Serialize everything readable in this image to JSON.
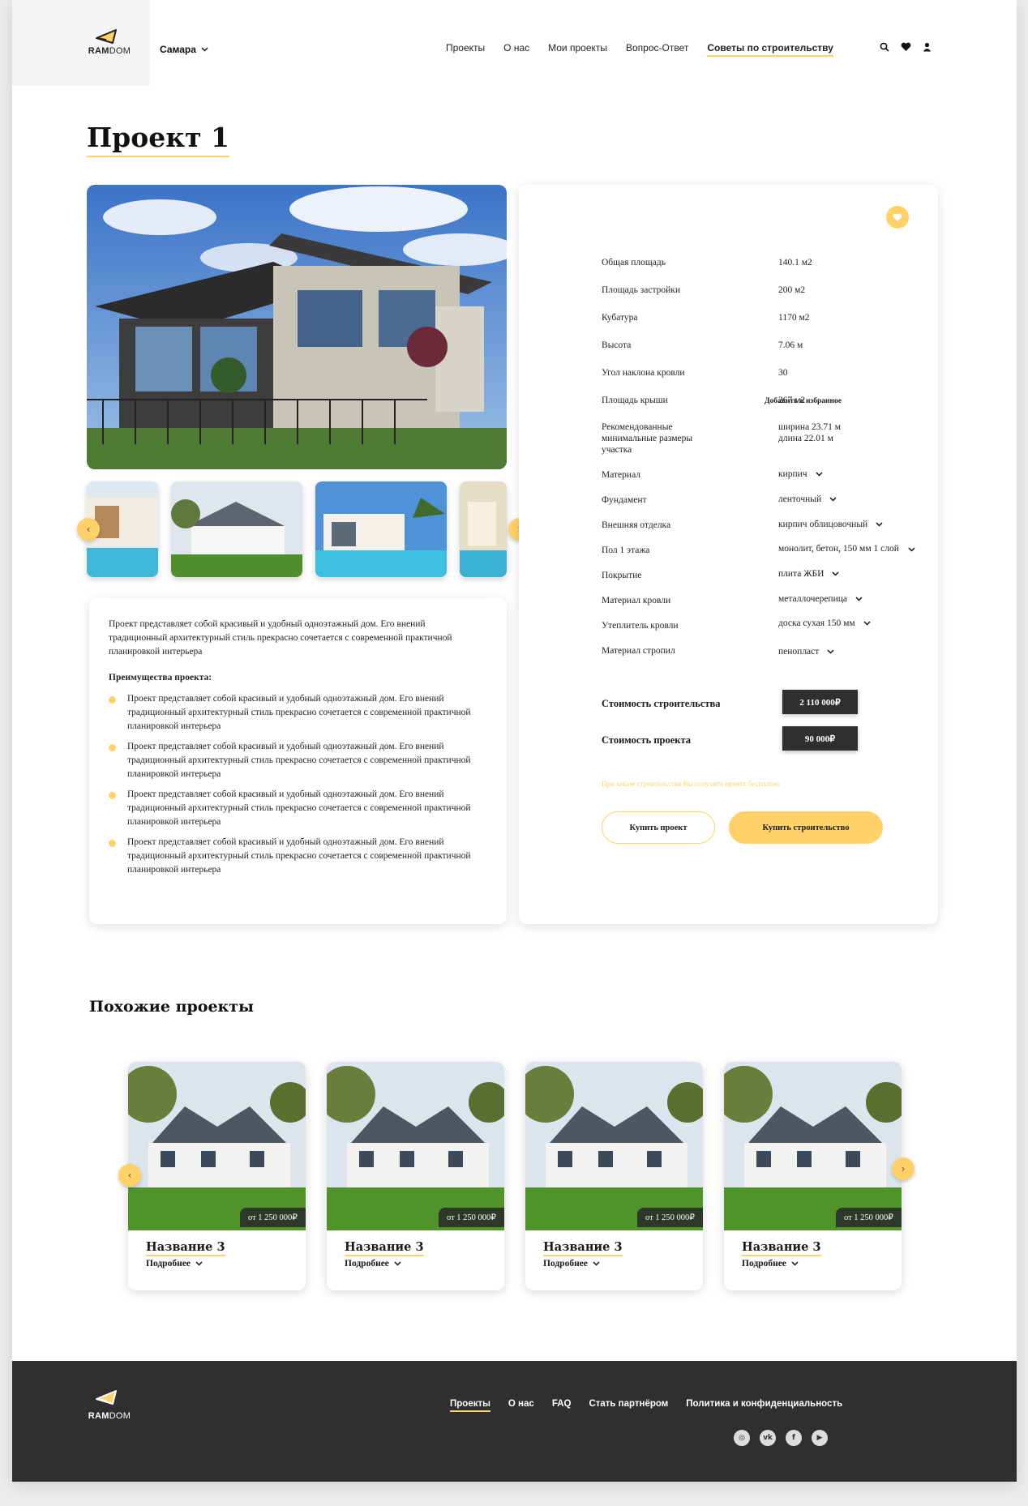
{
  "header": {
    "logo": {
      "text_bold": "RAM",
      "text_light": "DOM"
    },
    "city": "Самара",
    "nav": [
      {
        "label": "Проекты",
        "active": false
      },
      {
        "label": "О нас",
        "active": false
      },
      {
        "label": "Мои проекты",
        "active": false
      },
      {
        "label": "Вопрос-Ответ",
        "active": false
      },
      {
        "label": "Советы по строительству",
        "active": true
      }
    ],
    "icons": [
      "search-icon",
      "heart-icon",
      "user-icon"
    ]
  },
  "project": {
    "title": "Проект 1",
    "favorite_label": "Добавить в избранное",
    "specs": [
      {
        "label": "Общая площадь",
        "value": "140.1 м2"
      },
      {
        "label": "Площадь застройки",
        "value": "200 м2"
      },
      {
        "label": "Кубатура",
        "value": "1170 м2"
      },
      {
        "label": "Высота",
        "value": "7.06 м"
      },
      {
        "label": "Угол наклона кровли",
        "value": "30"
      },
      {
        "label": "Площадь крыши",
        "value": "267 м2"
      },
      {
        "label": "Рекомендованные минимальные размеры участка",
        "value": "ширина 23.71 м длина 22.01 м"
      }
    ],
    "options": [
      {
        "label": "Материал",
        "value": "кирпич"
      },
      {
        "label": "Фундамент",
        "value": "ленточный"
      },
      {
        "label": "Внешняя отделка",
        "value": "кирпич облицовочный"
      },
      {
        "label": "Пол 1 этажа",
        "value": "монолит, бетон, 150 мм 1 слой"
      },
      {
        "label": "Покрытие",
        "value": "плита ЖБИ"
      },
      {
        "label": "Материал кровли",
        "value": "металлочерепица"
      },
      {
        "label": "Утеплитель кровли",
        "value": "доска сухая 150 мм"
      },
      {
        "label": "Материал стропил",
        "value": "пенопласт"
      }
    ],
    "costs": [
      {
        "label": "Стоимость строительства",
        "value": "2 110 000₽"
      },
      {
        "label": "Стоимость проекта",
        "value": "90 000₽"
      }
    ],
    "promo": "При заказе строительства Вы получите проект бесплатно",
    "buy_project": "Купить проект",
    "buy_construction": "Купить строительство",
    "description": "Проект представляет собой красивый и удобный одноэтажный дом. Его внений традиционный архитектурный стиль прекрасно сочетается с современной практичной планировкой интерьера",
    "advantages_title": "Преимущества проекта:",
    "advantages": [
      "Проект представляет собой красивый и удобный одноэтажный дом. Его внений традиционный архитектурный стиль прекрасно сочетается с современной практичной планировкой интерьера",
      "Проект представляет собой красивый и удобный одноэтажный дом. Его внений традиционный архитектурный стиль прекрасно сочетается с современной практичной планировкой интерьера",
      "Проект представляет собой красивый и удобный одноэтажный дом. Его внений традиционный архитектурный стиль прекрасно сочетается с современной практичной планировкой интерьера",
      "Проект представляет собой красивый и удобный одноэтажный дом. Его внений традиционный архитектурный стиль прекрасно сочетается с современной практичной планировкой интерьера"
    ]
  },
  "similar": {
    "title": "Похожие проекты",
    "cards": [
      {
        "name": "Название 3",
        "price": "от 1 250 000₽",
        "more": "Подробнее"
      },
      {
        "name": "Название 3",
        "price": "от 1 250 000₽",
        "more": "Подробнее"
      },
      {
        "name": "Название 3",
        "price": "от 1 250 000₽",
        "more": "Подробнее"
      },
      {
        "name": "Название 3",
        "price": "от 1 250 000₽",
        "more": "Подробнее"
      }
    ]
  },
  "footer": {
    "nav": [
      {
        "label": "Проекты",
        "active": true
      },
      {
        "label": "О нас",
        "active": false
      },
      {
        "label": "FAQ",
        "active": false
      },
      {
        "label": "Стать партнёром",
        "active": false
      },
      {
        "label": "Политика и конфиденциальность",
        "active": false
      }
    ],
    "socials": [
      {
        "name": "instagram-icon",
        "glyph": "◎"
      },
      {
        "name": "vk-icon",
        "glyph": "vk"
      },
      {
        "name": "facebook-icon",
        "glyph": "f"
      },
      {
        "name": "youtube-icon",
        "glyph": "▶"
      }
    ]
  },
  "colors": {
    "accent": "#ffd166",
    "dark": "#2f2f2f",
    "bg": "#ffffff"
  }
}
